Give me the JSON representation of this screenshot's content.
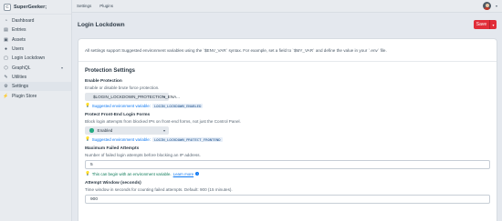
{
  "site": {
    "badge": "C",
    "name": "SuperGeeker;"
  },
  "topbar": {
    "links": [
      "Settings",
      "Plugins"
    ]
  },
  "sidebar": {
    "items": [
      {
        "label": "Dashboard",
        "icon": "gauge-icon"
      },
      {
        "label": "Entries",
        "icon": "newspaper-icon"
      },
      {
        "label": "Assets",
        "icon": "image-icon"
      },
      {
        "label": "Users",
        "icon": "users-icon"
      },
      {
        "label": "Login Lockdown",
        "icon": "lock-icon"
      },
      {
        "label": "GraphQL",
        "icon": "graphql-icon"
      },
      {
        "label": "Utilities",
        "icon": "wrench-icon"
      },
      {
        "label": "Settings",
        "icon": "gear-icon"
      },
      {
        "label": "Plugin Store",
        "icon": "plug-icon"
      }
    ]
  },
  "header": {
    "title": "Login Lockdown",
    "save_label": "Save"
  },
  "content": {
    "env_note": "All settings support Suggested environment variables using the `$ENV_VAR` syntax. For example, set a field to `$MY_VAR` and define the value in your `.env` file.",
    "section_title": "Protection Settings",
    "fields": {
      "enable": {
        "label": "Enable Protection",
        "help": "Enable or disable brute force protection.",
        "value": "$LOGIN_LOCKDOWN_PROTECTION_ENA...",
        "suggest_text": "Suggested environment variable:",
        "env_var": "LOGIN_LOCKDOWN_ENABLED"
      },
      "protect_front": {
        "label": "Protect Front-End Login Forms",
        "help": "Block login attempts from blocked IPs on front-end forms, not just the Control Panel.",
        "value": "Enabled",
        "suggest_text": "Suggested environment variable:",
        "env_var": "LOGIN_LOCKDOWN_PROTECT_FRONTEND"
      },
      "max_attempts": {
        "label": "Maximum Failed Attempts",
        "help": "Number of failed login attempts before blocking an IP address.",
        "value": "5",
        "tip_text": "This can begin with an environment variable.",
        "learn_more": "Learn more"
      },
      "attempt_window": {
        "label": "Attempt Window (seconds)",
        "help": "Time window in seconds for counting failed attempts. Default: 900 (15 minutes).",
        "value": "900"
      }
    }
  },
  "colors": {
    "accent_red": "#e12d39",
    "enabled_green": "#27ab83",
    "link_blue": "#0d78f2"
  }
}
